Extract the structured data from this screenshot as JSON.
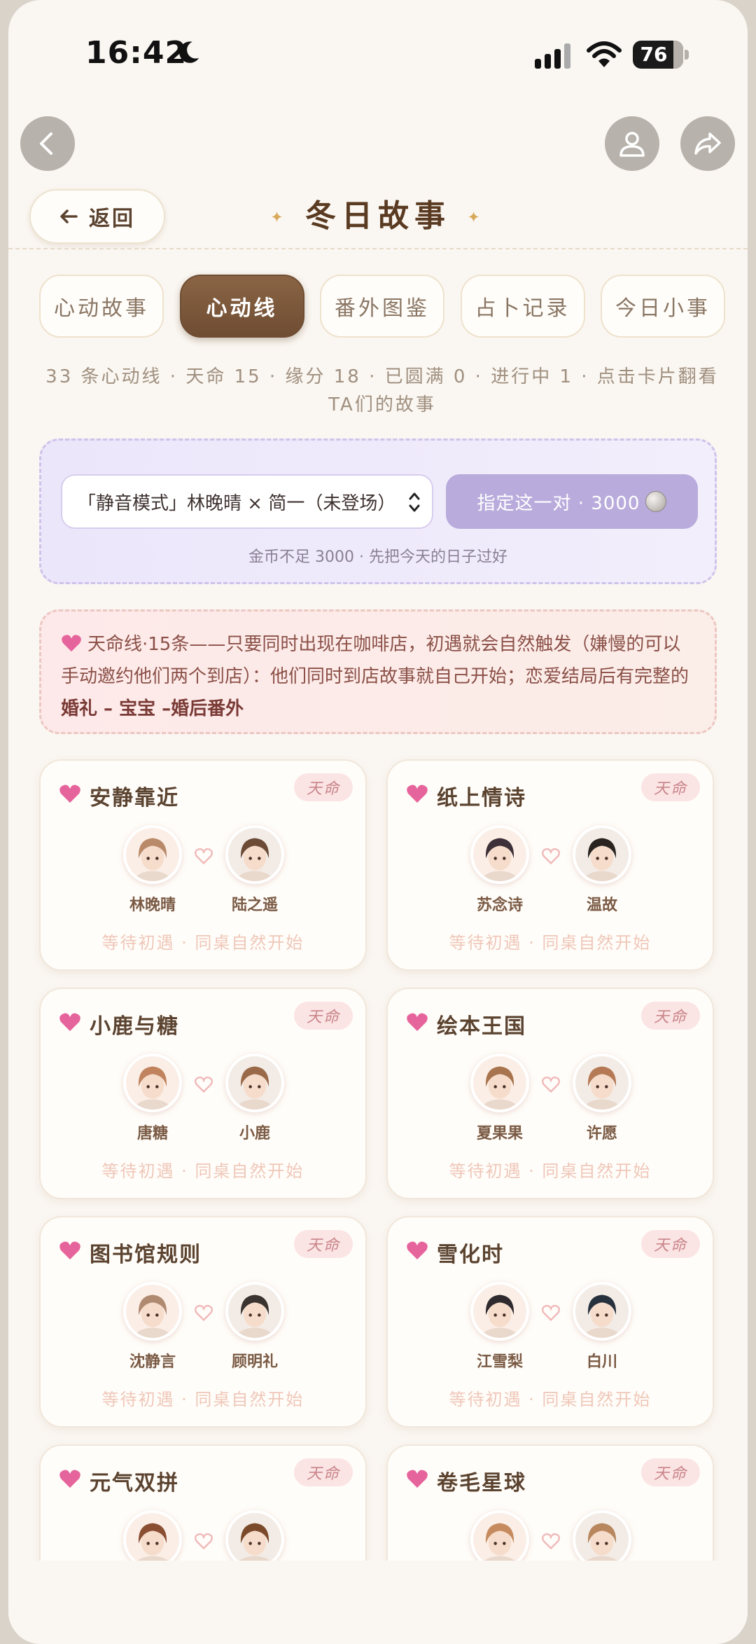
{
  "status_bar": {
    "time": "16:42",
    "battery": "76"
  },
  "header": {
    "back_label": "返回",
    "title": "冬日故事",
    "title_star": "✦"
  },
  "tabs": [
    {
      "label": "心动故事",
      "active": false
    },
    {
      "label": "心动线",
      "active": true
    },
    {
      "label": "番外图鉴",
      "active": false
    },
    {
      "label": "占卜记录",
      "active": false
    },
    {
      "label": "今日小事",
      "active": false
    }
  ],
  "stats_text": "33 条心动线 · 天命 15 · 缘分 18 · 已圆满 0 · 进行中 1 · 点击卡片翻看TA们的故事",
  "pick": {
    "selected_pair": "「静音模式」林晚晴 × 简一（未登场）",
    "assign_label": "指定这一对 · 3000",
    "note": "金币不足 3000 · 先把今天的日子过好"
  },
  "info": {
    "text": "天命线·15条——只要同时出现在咖啡店，初遇就会自然触发（嫌慢的可以手动邀约他们两个到店）：他们同时到店故事就自己开始；恋爱结局后有完整的",
    "bold": "婚礼 – 宝宝 –婚后番外"
  },
  "cards": [
    {
      "title": "安静靠近",
      "badge": "天命",
      "a": "林晚晴",
      "b": "陆之遥",
      "status": "等待初遇 · 同桌自然开始",
      "ca": "#b98a6a",
      "cb": "#6b4a36"
    },
    {
      "title": "纸上情诗",
      "badge": "天命",
      "a": "苏念诗",
      "b": "温故",
      "status": "等待初遇 · 同桌自然开始",
      "ca": "#3d3038",
      "cb": "#2a2420"
    },
    {
      "title": "小鹿与糖",
      "badge": "天命",
      "a": "唐糖",
      "b": "小鹿",
      "status": "等待初遇 · 同桌自然开始",
      "ca": "#c0835e",
      "cb": "#9a6a48"
    },
    {
      "title": "绘本王国",
      "badge": "天命",
      "a": "夏果果",
      "b": "许愿",
      "status": "等待初遇 · 同桌自然开始",
      "ca": "#a8744e",
      "cb": "#b57a55"
    },
    {
      "title": "图书馆规则",
      "badge": "天命",
      "a": "沈静言",
      "b": "顾明礼",
      "status": "等待初遇 · 同桌自然开始",
      "ca": "#b08a70",
      "cb": "#3a3330"
    },
    {
      "title": "雪化时",
      "badge": "天命",
      "a": "江雪梨",
      "b": "白川",
      "status": "等待初遇 · 同桌自然开始",
      "ca": "#2f2a2e",
      "cb": "#27313e"
    },
    {
      "title": "元气双拼",
      "badge": "天命",
      "a": "",
      "b": "",
      "status": "",
      "ca": "#8a4e33",
      "cb": "#7a4a2a"
    },
    {
      "title": "卷毛星球",
      "badge": "天命",
      "a": "",
      "b": "",
      "status": "",
      "ca": "#c58a5e",
      "cb": "#b8875e"
    }
  ],
  "colors": {
    "accent_brown": "#7a563a",
    "badge_pink": "#fbe4e4",
    "purple_button": "#b9acdc"
  }
}
